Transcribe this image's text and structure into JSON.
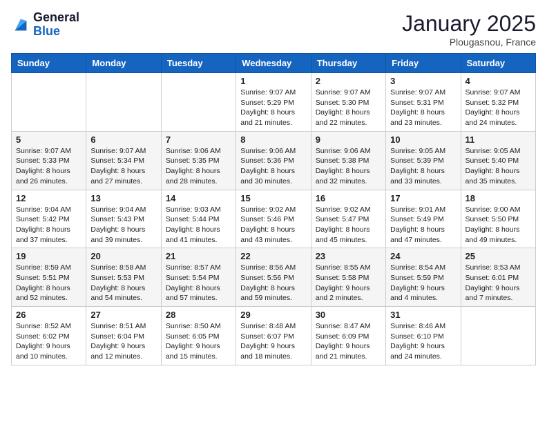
{
  "header": {
    "logo_general": "General",
    "logo_blue": "Blue",
    "month_title": "January 2025",
    "location": "Plougasnou, France"
  },
  "days_of_week": [
    "Sunday",
    "Monday",
    "Tuesday",
    "Wednesday",
    "Thursday",
    "Friday",
    "Saturday"
  ],
  "weeks": [
    [
      {
        "day": "",
        "info": ""
      },
      {
        "day": "",
        "info": ""
      },
      {
        "day": "",
        "info": ""
      },
      {
        "day": "1",
        "info": "Sunrise: 9:07 AM\nSunset: 5:29 PM\nDaylight: 8 hours and 21 minutes."
      },
      {
        "day": "2",
        "info": "Sunrise: 9:07 AM\nSunset: 5:30 PM\nDaylight: 8 hours and 22 minutes."
      },
      {
        "day": "3",
        "info": "Sunrise: 9:07 AM\nSunset: 5:31 PM\nDaylight: 8 hours and 23 minutes."
      },
      {
        "day": "4",
        "info": "Sunrise: 9:07 AM\nSunset: 5:32 PM\nDaylight: 8 hours and 24 minutes."
      }
    ],
    [
      {
        "day": "5",
        "info": "Sunrise: 9:07 AM\nSunset: 5:33 PM\nDaylight: 8 hours and 26 minutes."
      },
      {
        "day": "6",
        "info": "Sunrise: 9:07 AM\nSunset: 5:34 PM\nDaylight: 8 hours and 27 minutes."
      },
      {
        "day": "7",
        "info": "Sunrise: 9:06 AM\nSunset: 5:35 PM\nDaylight: 8 hours and 28 minutes."
      },
      {
        "day": "8",
        "info": "Sunrise: 9:06 AM\nSunset: 5:36 PM\nDaylight: 8 hours and 30 minutes."
      },
      {
        "day": "9",
        "info": "Sunrise: 9:06 AM\nSunset: 5:38 PM\nDaylight: 8 hours and 32 minutes."
      },
      {
        "day": "10",
        "info": "Sunrise: 9:05 AM\nSunset: 5:39 PM\nDaylight: 8 hours and 33 minutes."
      },
      {
        "day": "11",
        "info": "Sunrise: 9:05 AM\nSunset: 5:40 PM\nDaylight: 8 hours and 35 minutes."
      }
    ],
    [
      {
        "day": "12",
        "info": "Sunrise: 9:04 AM\nSunset: 5:42 PM\nDaylight: 8 hours and 37 minutes."
      },
      {
        "day": "13",
        "info": "Sunrise: 9:04 AM\nSunset: 5:43 PM\nDaylight: 8 hours and 39 minutes."
      },
      {
        "day": "14",
        "info": "Sunrise: 9:03 AM\nSunset: 5:44 PM\nDaylight: 8 hours and 41 minutes."
      },
      {
        "day": "15",
        "info": "Sunrise: 9:02 AM\nSunset: 5:46 PM\nDaylight: 8 hours and 43 minutes."
      },
      {
        "day": "16",
        "info": "Sunrise: 9:02 AM\nSunset: 5:47 PM\nDaylight: 8 hours and 45 minutes."
      },
      {
        "day": "17",
        "info": "Sunrise: 9:01 AM\nSunset: 5:49 PM\nDaylight: 8 hours and 47 minutes."
      },
      {
        "day": "18",
        "info": "Sunrise: 9:00 AM\nSunset: 5:50 PM\nDaylight: 8 hours and 49 minutes."
      }
    ],
    [
      {
        "day": "19",
        "info": "Sunrise: 8:59 AM\nSunset: 5:51 PM\nDaylight: 8 hours and 52 minutes."
      },
      {
        "day": "20",
        "info": "Sunrise: 8:58 AM\nSunset: 5:53 PM\nDaylight: 8 hours and 54 minutes."
      },
      {
        "day": "21",
        "info": "Sunrise: 8:57 AM\nSunset: 5:54 PM\nDaylight: 8 hours and 57 minutes."
      },
      {
        "day": "22",
        "info": "Sunrise: 8:56 AM\nSunset: 5:56 PM\nDaylight: 8 hours and 59 minutes."
      },
      {
        "day": "23",
        "info": "Sunrise: 8:55 AM\nSunset: 5:58 PM\nDaylight: 9 hours and 2 minutes."
      },
      {
        "day": "24",
        "info": "Sunrise: 8:54 AM\nSunset: 5:59 PM\nDaylight: 9 hours and 4 minutes."
      },
      {
        "day": "25",
        "info": "Sunrise: 8:53 AM\nSunset: 6:01 PM\nDaylight: 9 hours and 7 minutes."
      }
    ],
    [
      {
        "day": "26",
        "info": "Sunrise: 8:52 AM\nSunset: 6:02 PM\nDaylight: 9 hours and 10 minutes."
      },
      {
        "day": "27",
        "info": "Sunrise: 8:51 AM\nSunset: 6:04 PM\nDaylight: 9 hours and 12 minutes."
      },
      {
        "day": "28",
        "info": "Sunrise: 8:50 AM\nSunset: 6:05 PM\nDaylight: 9 hours and 15 minutes."
      },
      {
        "day": "29",
        "info": "Sunrise: 8:48 AM\nSunset: 6:07 PM\nDaylight: 9 hours and 18 minutes."
      },
      {
        "day": "30",
        "info": "Sunrise: 8:47 AM\nSunset: 6:09 PM\nDaylight: 9 hours and 21 minutes."
      },
      {
        "day": "31",
        "info": "Sunrise: 8:46 AM\nSunset: 6:10 PM\nDaylight: 9 hours and 24 minutes."
      },
      {
        "day": "",
        "info": ""
      }
    ]
  ]
}
